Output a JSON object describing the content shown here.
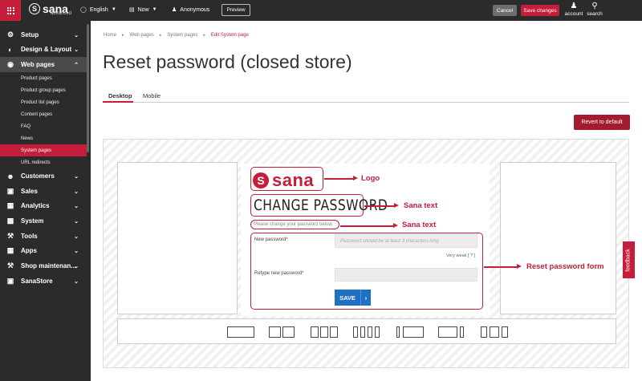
{
  "topbar": {
    "logo": "sana",
    "logo_sub": "advanced",
    "language": "English",
    "date": "Now",
    "user": "Anonymous",
    "preview": "Preview",
    "cancel": "Cancel",
    "save_changes": "Save changes",
    "account": "account",
    "search": "search"
  },
  "sidebar": {
    "items": [
      {
        "label": "Setup",
        "icon": "gear-icon"
      },
      {
        "label": "Design & Layout",
        "icon": "palette-icon"
      },
      {
        "label": "Web pages",
        "icon": "globe-icon"
      },
      {
        "label": "Customers",
        "icon": "users-icon"
      },
      {
        "label": "Sales",
        "icon": "cart-icon"
      },
      {
        "label": "Analytics",
        "icon": "chart-icon"
      },
      {
        "label": "System",
        "icon": "sitemap-icon"
      },
      {
        "label": "Tools",
        "icon": "wrench-icon"
      },
      {
        "label": "Apps",
        "icon": "apps-icon"
      },
      {
        "label": "Shop maintenan...",
        "icon": "maintenance-icon"
      },
      {
        "label": "SanaStore",
        "icon": "store-icon"
      }
    ],
    "subitems": [
      "Product pages",
      "Product group pages",
      "Product list pages",
      "Content pages",
      "FAQ",
      "News",
      "System pages",
      "URL redirects"
    ]
  },
  "breadcrumb": [
    "Home",
    "Web pages",
    "System pages",
    "Edit System page"
  ],
  "page_title": "Reset password (closed store)",
  "tabs": [
    "Desktop",
    "Mobile"
  ],
  "revert_button": "Revert to default",
  "preview": {
    "logo_text": "sana",
    "heading": "CHANGE PASSWORD",
    "subtitle": "Please change your password below",
    "new_password_label": "New password*",
    "new_password_placeholder": "Password should be at least 3 characters long",
    "strength_text": "Very weak",
    "strength_help": "[ ? ]",
    "retype_label": "Retype new password*",
    "save_button": "SAVE",
    "save_arrow": "›"
  },
  "annotations": {
    "logo": "Logo",
    "sana_text_1": "Sana text",
    "sana_text_2": "Sana text",
    "form": "Reset password form"
  },
  "feedback": "feedback",
  "colors": {
    "accent": "#c41e3a",
    "topbar": "#2b2b2b",
    "button_blue": "#1f6fc4"
  }
}
